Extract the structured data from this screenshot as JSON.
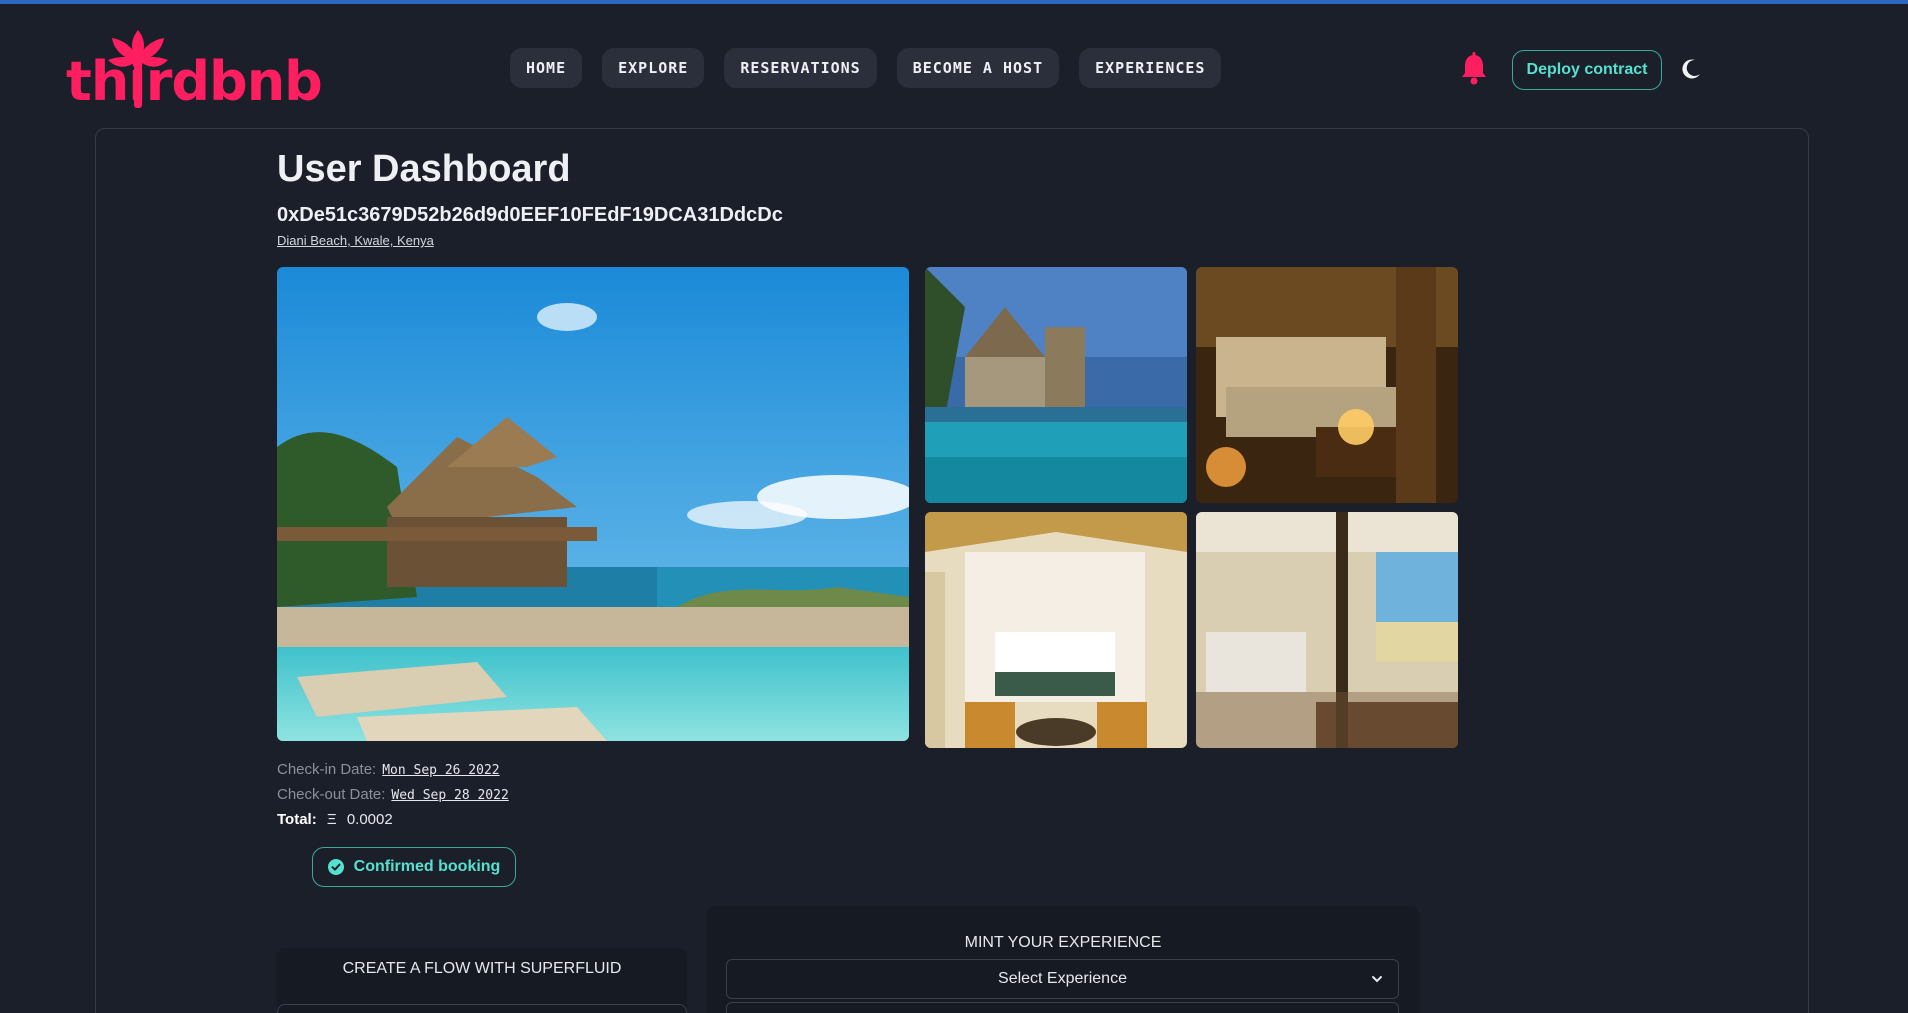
{
  "brand": {
    "name": "thirdbnb",
    "color": "#ff1e60"
  },
  "nav": {
    "items": [
      {
        "label": "HOME"
      },
      {
        "label": "EXPLORE"
      },
      {
        "label": "RESERVATIONS"
      },
      {
        "label": "BECOME A HOST"
      },
      {
        "label": "EXPERIENCES"
      }
    ]
  },
  "header": {
    "deploy_label": "Deploy contract",
    "notification_icon": "bell-icon",
    "theme_icon": "moon-icon"
  },
  "dashboard": {
    "title": "User Dashboard",
    "address": "0xDe51c3679D52b26d9d0EEF10FEdF19DCA31DdcDc",
    "location": "Diani Beach, Kwale, Kenya"
  },
  "booking": {
    "checkin_label": "Check-in Date:",
    "checkin_value": "Mon Sep 26 2022",
    "checkout_label": "Check-out Date:",
    "checkout_value": "Wed Sep 28 2022",
    "total_label": "Total:",
    "currency_symbol": "Ξ",
    "total_value": "0.0002",
    "status_label": "Confirmed booking",
    "status_icon": "check-circle-icon"
  },
  "flow": {
    "title": "CREATE A FLOW WITH SUPERFLUID"
  },
  "mint": {
    "title": "MINT YOUR EXPERIENCE",
    "select_value": "Select Experience"
  },
  "colors": {
    "accent": "#56e0cf",
    "background": "#1b1f2a",
    "nav_bg": "#2a2f3b"
  }
}
